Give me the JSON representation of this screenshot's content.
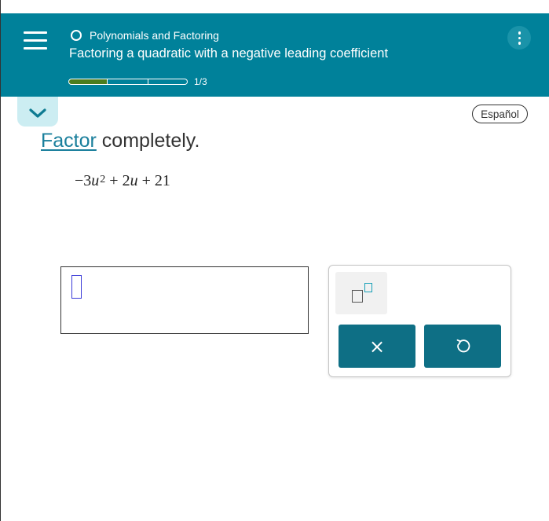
{
  "header": {
    "topic": "Polynomials and Factoring",
    "title": "Factoring a quadratic with a negative leading coefficient",
    "progress_text": "1/3",
    "progress_fraction": 0.333,
    "icons": {
      "menu": "hamburger-menu-icon",
      "topic": "circle-icon",
      "more": "vertical-ellipsis-icon"
    },
    "colors": {
      "background": "#00819a",
      "progress_fill": "#4b7d1e"
    }
  },
  "toolbar": {
    "collapse_icon": "chevron-down-icon",
    "language_label": "Español"
  },
  "question": {
    "prompt_link": "Factor",
    "prompt_rest": " completely.",
    "expression": {
      "coef1": "−3",
      "var1": "u",
      "exp1": "2",
      "op1": "+",
      "term2_coef": "2",
      "term2_var": "u",
      "op2": "+",
      "const": "21"
    }
  },
  "answer": {
    "value": ""
  },
  "palette": {
    "exponent_icon": "exponent-template-icon",
    "clear_label": "×",
    "undo_icon": "undo-icon",
    "button_color": "#0e6f85"
  }
}
